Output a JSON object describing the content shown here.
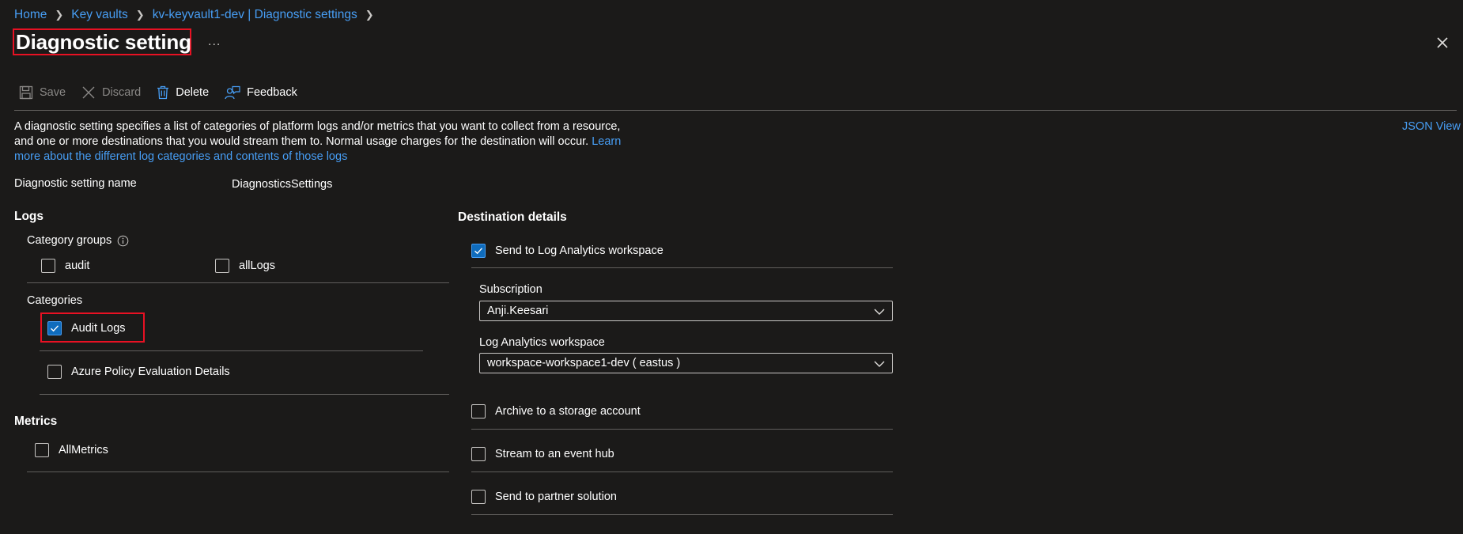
{
  "breadcrumb": {
    "items": [
      "Home",
      "Key vaults",
      "kv-keyvault1-dev | Diagnostic settings"
    ]
  },
  "header": {
    "title": "Diagnostic setting",
    "more": "...",
    "close_icon": "close-icon"
  },
  "toolbar": {
    "save_label": "Save",
    "discard_label": "Discard",
    "delete_label": "Delete",
    "feedback_label": "Feedback"
  },
  "description": {
    "text": "A diagnostic setting specifies a list of categories of platform logs and/or metrics that you want to collect from a resource, and one or more destinations that you would stream them to. Normal usage charges for the destination will occur.",
    "link_text": "Learn more about the different log categories and contents of those logs"
  },
  "json_view_label": "JSON View",
  "setting_name": {
    "label": "Diagnostic setting name",
    "value": "DiagnosticsSettings"
  },
  "logs": {
    "heading": "Logs",
    "category_groups_label": "Category groups",
    "info_icon": "info-icon",
    "groups": [
      {
        "label": "audit",
        "checked": false
      },
      {
        "label": "allLogs",
        "checked": false
      }
    ],
    "categories_label": "Categories",
    "categories": [
      {
        "label": "Audit Logs",
        "checked": true
      },
      {
        "label": "Azure Policy Evaluation Details",
        "checked": false
      }
    ]
  },
  "metrics": {
    "heading": "Metrics",
    "items": [
      {
        "label": "AllMetrics",
        "checked": false
      }
    ]
  },
  "destination": {
    "heading": "Destination details",
    "log_analytics": {
      "label": "Send to Log Analytics workspace",
      "checked": true
    },
    "subscription_label": "Subscription",
    "subscription_value": "Anji.Keesari",
    "workspace_label": "Log Analytics workspace",
    "workspace_value": "workspace-workspace1-dev ( eastus )",
    "archive": {
      "label": "Archive to a storage account",
      "checked": false
    },
    "event_hub": {
      "label": "Stream to an event hub",
      "checked": false
    },
    "partner": {
      "label": "Send to partner solution",
      "checked": false
    }
  },
  "colors": {
    "background": "#1b1a19",
    "link": "#479ef5",
    "checked": "#0f6cbd",
    "highlight": "#e81123"
  }
}
